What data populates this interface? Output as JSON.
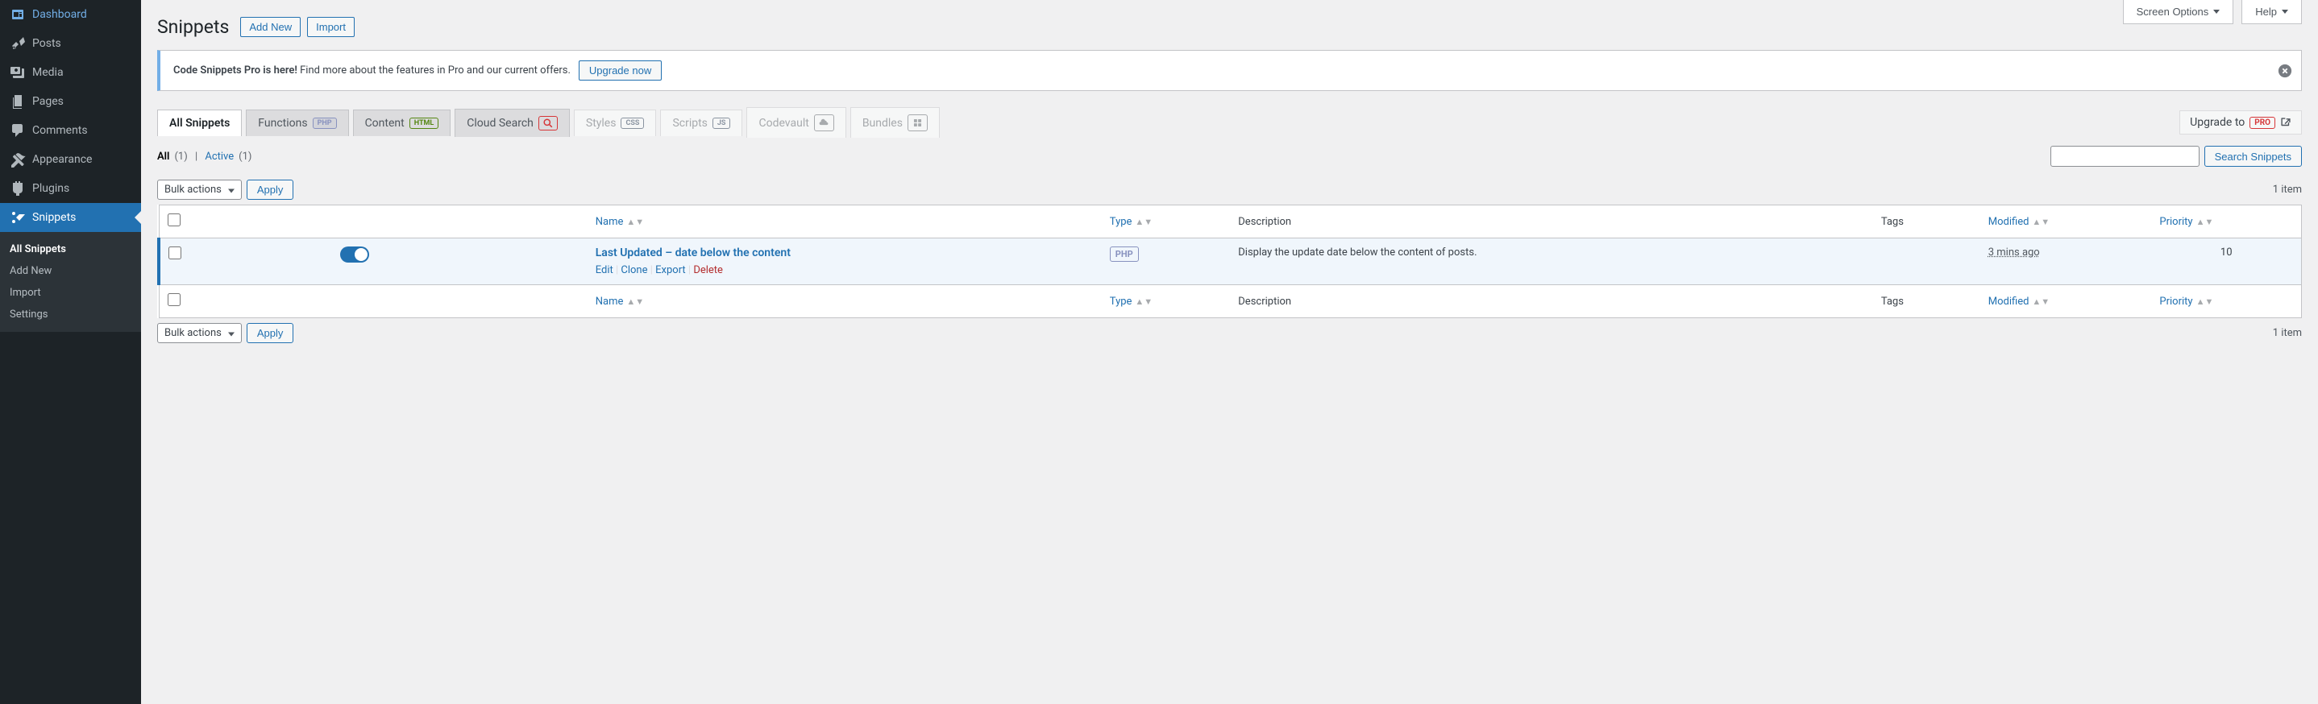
{
  "sidebar": {
    "items": [
      {
        "label": "Dashboard",
        "icon": "dashboard"
      },
      {
        "label": "Posts",
        "icon": "posts"
      },
      {
        "label": "Media",
        "icon": "media"
      },
      {
        "label": "Pages",
        "icon": "pages"
      },
      {
        "label": "Comments",
        "icon": "comments"
      },
      {
        "label": "Appearance",
        "icon": "appearance"
      },
      {
        "label": "Plugins",
        "icon": "plugins"
      },
      {
        "label": "Snippets",
        "icon": "snippets",
        "current": true
      }
    ],
    "submenu": [
      {
        "label": "All Snippets",
        "current": true
      },
      {
        "label": "Add New"
      },
      {
        "label": "Import"
      },
      {
        "label": "Settings"
      }
    ]
  },
  "screen_meta": {
    "screen_options": "Screen Options",
    "help": "Help"
  },
  "header": {
    "title": "Snippets",
    "add_new": "Add New",
    "import": "Import"
  },
  "notice": {
    "strong": "Code Snippets Pro is here!",
    "text": " Find more about the features in Pro and our current offers. ",
    "upgrade": "Upgrade now"
  },
  "tabs": {
    "all": "All Snippets",
    "functions": "Functions",
    "functions_badge": "PHP",
    "content": "Content",
    "content_badge": "HTML",
    "cloud": "Cloud Search",
    "styles": "Styles",
    "styles_badge": "CSS",
    "scripts": "Scripts",
    "scripts_badge": "JS",
    "codevault": "Codevault",
    "bundles": "Bundles",
    "upgrade_to": "Upgrade to",
    "pro_badge": "PRO"
  },
  "subsubsub": {
    "all": "All",
    "all_count": "(1)",
    "active": "Active",
    "active_count": "(1)"
  },
  "search": {
    "button": "Search Snippets"
  },
  "bulk": {
    "select": "Bulk actions",
    "apply": "Apply"
  },
  "item_count": "1 item",
  "columns": {
    "name": "Name",
    "type": "Type",
    "description": "Description",
    "tags": "Tags",
    "modified": "Modified",
    "priority": "Priority"
  },
  "rows": [
    {
      "title": "Last Updated – date below the content",
      "type": "PHP",
      "description": "Display the update date below the content of posts.",
      "modified": "3 mins ago",
      "priority": "10"
    }
  ],
  "row_actions": {
    "edit": "Edit",
    "clone": "Clone",
    "export": "Export",
    "delete": "Delete"
  }
}
